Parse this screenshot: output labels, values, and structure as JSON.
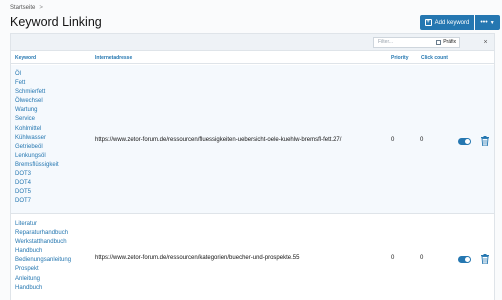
{
  "breadcrumb": {
    "home": "Startseite",
    "separator": ">"
  },
  "page": {
    "title": "Keyword Linking"
  },
  "toolbar": {
    "add_label": "Add keyword",
    "menu_label": "•••"
  },
  "filter": {
    "placeholder": "Filter...",
    "prefix_label": "Präfix",
    "clear_label": "×"
  },
  "table": {
    "headers": {
      "keyword": "Keyword",
      "url": "Internetadresse",
      "priority": "Priority",
      "clicks": "Click count"
    },
    "rows": [
      {
        "keywords": [
          "Öl",
          "Fett",
          "Schmierfett",
          "Ölwechsel",
          "Wartung",
          "Service",
          "Kohlmittel",
          "Kühlwasser",
          "Getriebeöl",
          "Lenkungsöl",
          "Bremsflüssigkeit",
          "DOT3",
          "DOT4",
          "DOT5",
          "DOT7"
        ],
        "url": "https://www.zetor-forum.de/ressourcen/fluessigkeiten-uebersicht-oele-kuehlw-bremsfl-fett.27/",
        "priority": "0",
        "clicks": "0",
        "enabled": true
      },
      {
        "keywords": [
          "Literatur",
          "Reparaturhandbuch",
          "Werkstatthandbuch",
          "Handbuch",
          "Bedienungsanleitung",
          "Prospekt",
          "Anleitung",
          "Handbuch"
        ],
        "url": "https://www.zetor-forum.de/ressourcen/kategorien/buecher-und-prospekte.55",
        "priority": "0",
        "clicks": "0",
        "enabled": true
      }
    ]
  },
  "colors": {
    "accent": "#2577b1",
    "row_highlight": "#f5f9fd",
    "border": "#dfe4e9"
  }
}
